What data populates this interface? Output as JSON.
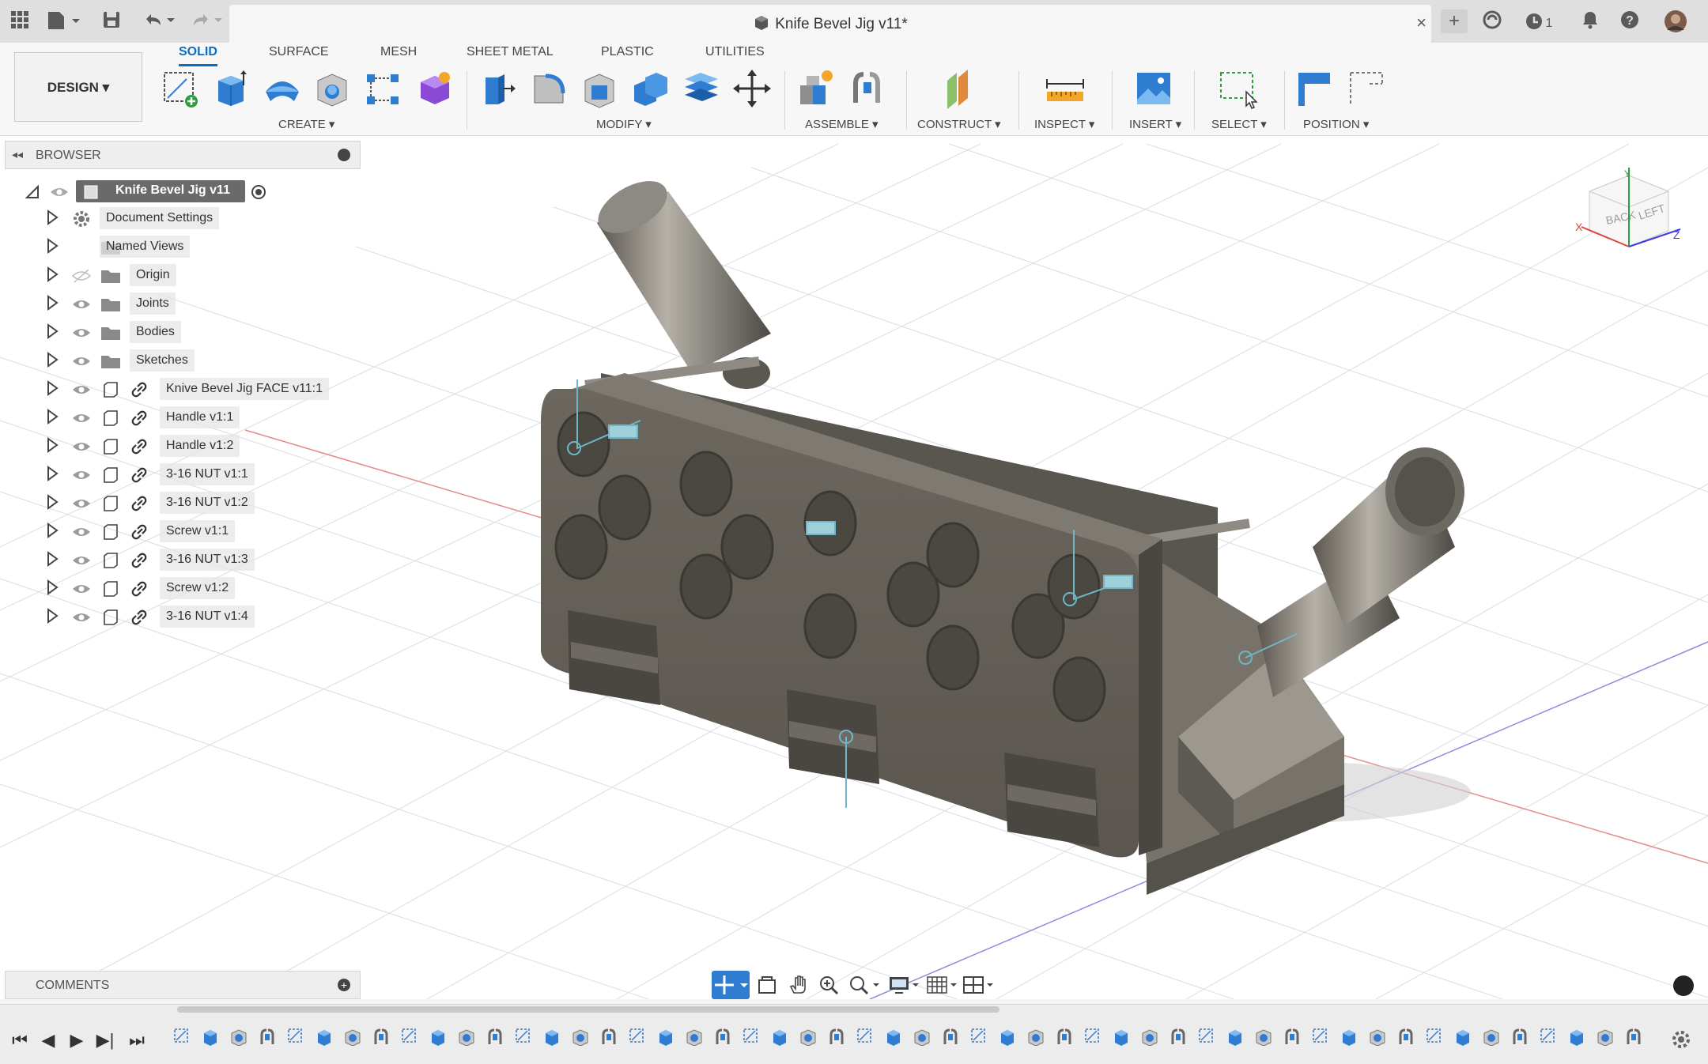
{
  "title_bar": {
    "document_title": "Knife Bevel Jig v11*",
    "close_symbol": "×",
    "jobs_count": "1"
  },
  "toolbar": {
    "tabs": [
      "SOLID",
      "SURFACE",
      "MESH",
      "SHEET METAL",
      "PLASTIC",
      "UTILITIES"
    ],
    "active_tab": "SOLID",
    "workspace": "DESIGN ▾",
    "groups": {
      "create": "CREATE ▾",
      "modify": "MODIFY ▾",
      "assemble": "ASSEMBLE ▾",
      "construct": "CONSTRUCT ▾",
      "inspect": "INSPECT ▾",
      "insert": "INSERT ▾",
      "select": "SELECT ▾",
      "position": "POSITION ▾"
    },
    "accent_color": "#0a6dc2"
  },
  "browser": {
    "title": "BROWSER",
    "root": "Knife Bevel Jig v11",
    "items": [
      {
        "label": "Document Settings",
        "icon": "gear-icon",
        "eye": false
      },
      {
        "label": "Named Views",
        "icon": "folder-icon",
        "eye": false
      },
      {
        "label": "Origin",
        "icon": "folder-icon",
        "eye": "hidden"
      },
      {
        "label": "Joints",
        "icon": "folder-icon",
        "eye": true
      },
      {
        "label": "Bodies",
        "icon": "folder-icon",
        "eye": true
      },
      {
        "label": "Sketches",
        "icon": "folder-icon",
        "eye": true
      },
      {
        "label": "Knive Bevel Jig FACE v11:1",
        "icon": "component-link-icon",
        "eye": true
      },
      {
        "label": "Handle v1:1",
        "icon": "component-link-icon",
        "eye": true
      },
      {
        "label": "Handle v1:2",
        "icon": "component-link-icon",
        "eye": true
      },
      {
        "label": "3-16 NUT v1:1",
        "icon": "component-link-icon",
        "eye": true
      },
      {
        "label": "3-16 NUT v1:2",
        "icon": "component-link-icon",
        "eye": true
      },
      {
        "label": "Screw v1:1",
        "icon": "component-link-icon",
        "eye": true
      },
      {
        "label": "3-16 NUT v1:3",
        "icon": "component-link-icon",
        "eye": true
      },
      {
        "label": "Screw v1:2",
        "icon": "component-link-icon",
        "eye": true
      },
      {
        "label": "3-16 NUT v1:4",
        "icon": "component-link-icon",
        "eye": true
      }
    ]
  },
  "viewcube": {
    "back": "BACK",
    "left": "LEFT",
    "x": "X",
    "y": "Y",
    "z": "Z"
  },
  "comments": {
    "title": "COMMENTS"
  },
  "timeline": {
    "controls": [
      "⏮",
      "◀",
      "▶",
      "▶|",
      "⏭"
    ],
    "item_count": 52
  }
}
